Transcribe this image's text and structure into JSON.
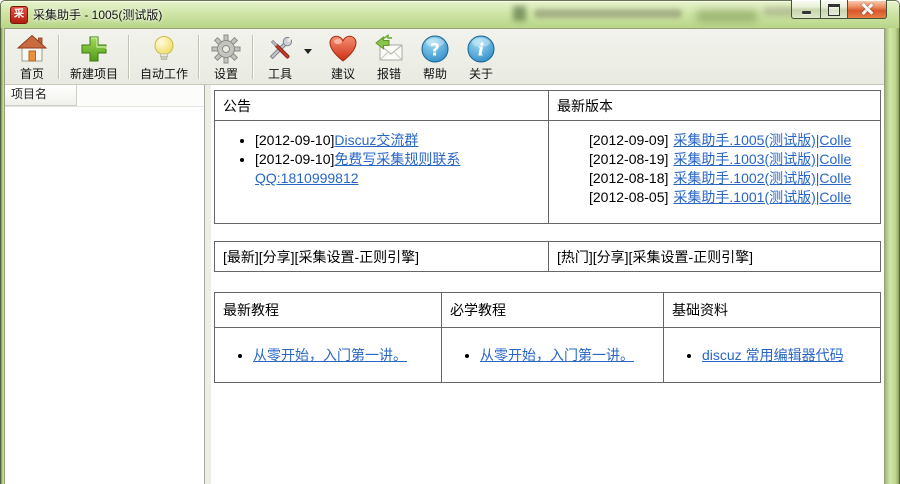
{
  "window": {
    "title": "采集助手 - 1005(测试版)",
    "icon_char": "采",
    "controls": [
      "minimize-button",
      "maximize-button",
      "close-button"
    ]
  },
  "colors": {
    "titlebar_green": "#cfe5a7",
    "toolbar_bg": "#eeefe7",
    "link_blue": "#2866c6",
    "close_red": "#d8572a",
    "table_border": "#666666"
  },
  "icons": {
    "app": "red-square-cai-logo",
    "home": "house-icon",
    "new_project": "green-plus-icon",
    "auto_work": "lightbulb-icon",
    "settings": "gear-icon",
    "tools": "hammer-wrench-icon",
    "suggest": "heart-icon",
    "report": "envelope-arrows-icon",
    "help": "question-circle-icon",
    "about": "info-circle-icon"
  },
  "toolbar": {
    "items": [
      {
        "label": "首页"
      },
      {
        "label": "新建项目"
      },
      {
        "label": "自动工作"
      },
      {
        "label": "设置"
      },
      {
        "label": "工具"
      },
      {
        "label": "建议"
      },
      {
        "label": "报错"
      },
      {
        "label": "帮助"
      },
      {
        "label": "关于"
      }
    ]
  },
  "sidebar": {
    "column_header": "项目名"
  },
  "main": {
    "announcements": {
      "header": "公告",
      "items": [
        {
          "date": "[2012-09-10]",
          "link": "Discuz交流群"
        },
        {
          "date": "[2012-09-10]",
          "link": "免费写采集规则联系QQ:1810999812"
        }
      ]
    },
    "versions": {
      "header": "最新版本",
      "items": [
        {
          "date": "[2012-09-09]",
          "link": "采集助手.1005(测试版)|Colle"
        },
        {
          "date": "[2012-08-19]",
          "link": "采集助手.1003(测试版)|Colle"
        },
        {
          "date": "[2012-08-18]",
          "link": "采集助手.1002(测试版)|Colle"
        },
        {
          "date": "[2012-08-05]",
          "link": "采集助手.1001(测试版)|Colle"
        }
      ]
    },
    "share_row": {
      "left": "[最新][分享][采集设置-正则引擎]",
      "right": "[热门][分享][采集设置-正则引擎]"
    },
    "tutorials": {
      "columns": [
        {
          "header": "最新教程",
          "link": "从零开始，入门第一讲。"
        },
        {
          "header": "必学教程",
          "link": "从零开始，入门第一讲。"
        },
        {
          "header": "基础资料",
          "link": "discuz 常用编辑器代码"
        }
      ]
    }
  }
}
